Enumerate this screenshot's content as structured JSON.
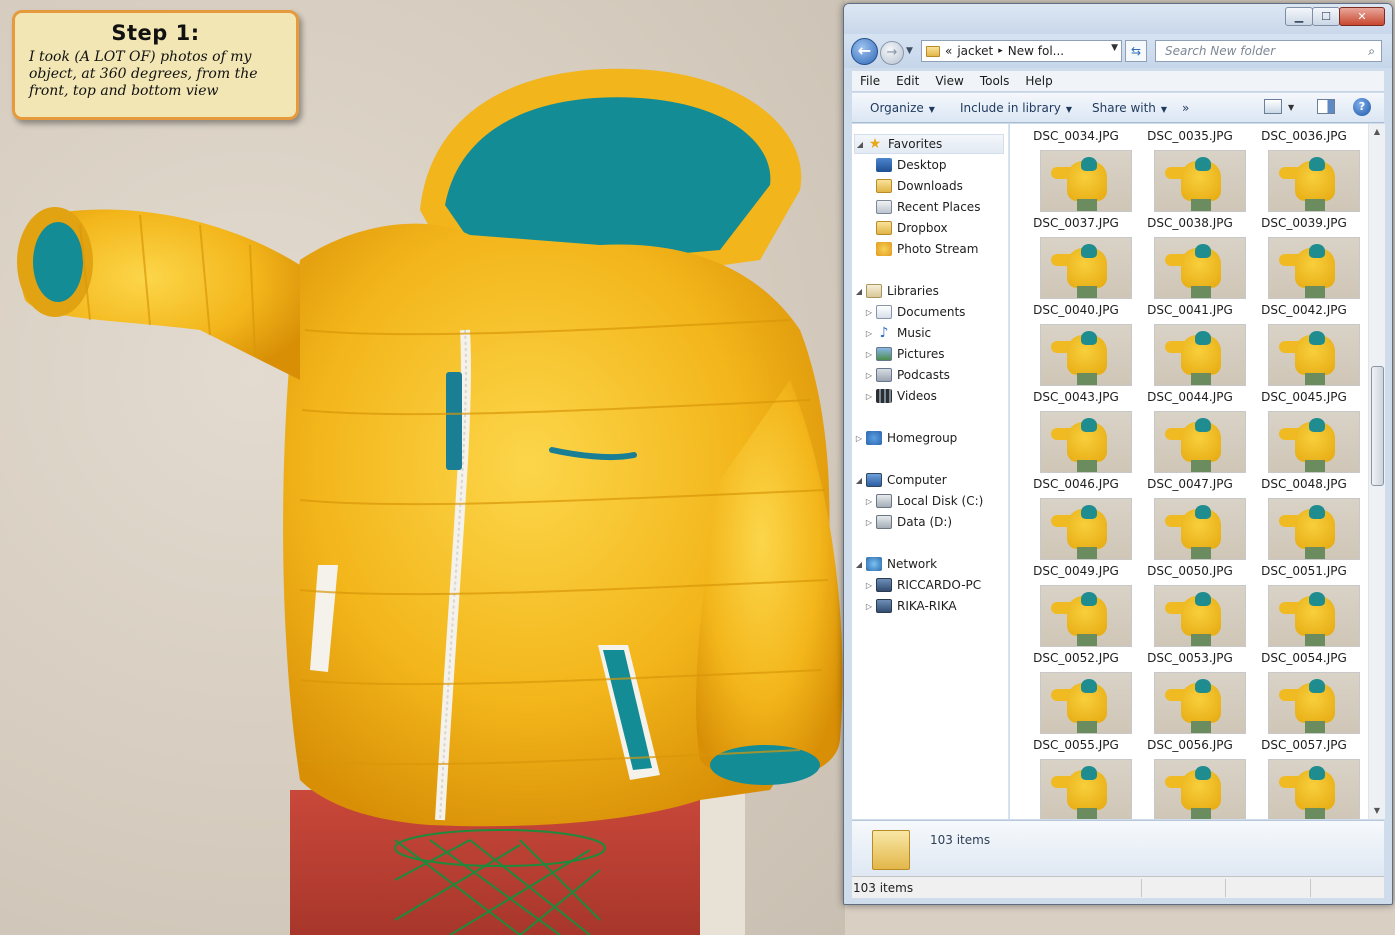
{
  "tutorial": {
    "title": "Step 1:",
    "text": "I took (A LOT OF) photos of my object, at 360 degrees, from the front, top and bottom view"
  },
  "window": {
    "controls": {
      "minimize": "▁",
      "maximize": "☐",
      "close": "✕"
    },
    "address": {
      "chevron": "«",
      "segment_1": "jacket",
      "separator": "▸",
      "segment_2": "New fol..."
    },
    "search_placeholder": "Search New folder",
    "menu": [
      "File",
      "Edit",
      "View",
      "Tools",
      "Help"
    ],
    "commands": {
      "organize": "Organize",
      "include": "Include in library",
      "share": "Share with",
      "more": "»"
    },
    "nav": {
      "favorites": "Favorites",
      "favorite_items": [
        "Desktop",
        "Downloads",
        "Recent Places",
        "Dropbox",
        "Photo Stream"
      ],
      "libraries": "Libraries",
      "library_items": [
        "Documents",
        "Music",
        "Pictures",
        "Podcasts",
        "Videos"
      ],
      "homegroup": "Homegroup",
      "computer": "Computer",
      "computer_items": [
        "Local Disk (C:)",
        "Data (D:)"
      ],
      "network": "Network",
      "network_items": [
        "RICCARDO-PC",
        "RIKA-RIKA"
      ]
    },
    "files": [
      "DSC_0034.JPG",
      "DSC_0035.JPG",
      "DSC_0036.JPG",
      "DSC_0037.JPG",
      "DSC_0038.JPG",
      "DSC_0039.JPG",
      "DSC_0040.JPG",
      "DSC_0041.JPG",
      "DSC_0042.JPG",
      "DSC_0043.JPG",
      "DSC_0044.JPG",
      "DSC_0045.JPG",
      "DSC_0046.JPG",
      "DSC_0047.JPG",
      "DSC_0048.JPG",
      "DSC_0049.JPG",
      "DSC_0050.JPG",
      "DSC_0051.JPG",
      "DSC_0052.JPG",
      "DSC_0053.JPG",
      "DSC_0054.JPG",
      "DSC_0055.JPG",
      "DSC_0056.JPG",
      "DSC_0057.JPG"
    ],
    "details_count": "103 items",
    "status_text": "103 items"
  },
  "colors": {
    "jacket": "#f2b51c",
    "lining": "#138c95",
    "card_border": "#e59a3c",
    "card_fill": "#f2e6b4"
  }
}
